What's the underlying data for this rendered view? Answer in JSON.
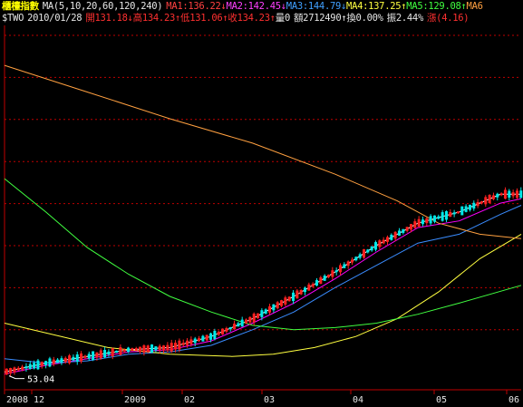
{
  "header": {
    "name": "櫃檯指數",
    "ma_spec": "MA(5,10,20,60,120,240)",
    "ma_items": [
      {
        "label": "MA1:136.22↓",
        "color": "#ff4040"
      },
      {
        "label": "MA2:142.45↓",
        "color": "#ff40ff"
      },
      {
        "label": "MA3:144.79↓",
        "color": "#40a0ff"
      },
      {
        "label": "MA4:137.25↑",
        "color": "#ffff40"
      },
      {
        "label": "MA5:129.08↑",
        "color": "#40ff40"
      },
      {
        "label": "MA6",
        "color": "#ffa040"
      }
    ],
    "symbol": "$TWO",
    "date": "2010/01/28",
    "open": "開131.18↓",
    "high": "高134.23↑",
    "low": "低131.06↑",
    "close": "收134.23↑",
    "volume": "量0",
    "amount": "額2712490↑",
    "turnover": "換0.00%",
    "amplitude": "振2.44%",
    "change": "漲(4.16)"
  },
  "chart_data": {
    "type": "line",
    "title": "櫃檯指數",
    "x_tick_labels": [
      "2008",
      "12",
      "2009",
      "02",
      "03",
      "04",
      "05",
      "06"
    ],
    "annotations": [
      "53.04"
    ],
    "min_marker": 53.04,
    "grid": true,
    "colors": {
      "up": "#ff2020",
      "down": "#00e8e8",
      "grid": "#c00000",
      "MA5": "#ffffff",
      "MA10": "#ff00ff",
      "MA20": "#3a8cff",
      "MA60": "#ffff40",
      "MA120": "#40ff40",
      "MA240": "#ffa040"
    },
    "series": [
      {
        "name": "MA5",
        "x": [
          0,
          10,
          20,
          30,
          40,
          50,
          60,
          70,
          80,
          90,
          100,
          110,
          120,
          125
        ],
        "values": [
          56,
          60,
          63,
          66,
          67,
          72,
          80,
          90,
          101,
          113,
          123,
          128,
          136,
          136
        ]
      },
      {
        "name": "MA10",
        "x": [
          0,
          10,
          20,
          30,
          40,
          50,
          60,
          70,
          80,
          90,
          100,
          110,
          120,
          125
        ],
        "values": [
          55,
          59,
          62,
          65,
          66,
          70,
          78,
          87,
          98,
          110,
          121,
          124,
          132,
          134
        ]
      },
      {
        "name": "MA20",
        "x": [
          0,
          10,
          20,
          30,
          40,
          50,
          60,
          70,
          80,
          90,
          100,
          110,
          120,
          125
        ],
        "values": [
          62,
          60,
          61,
          64,
          65,
          68,
          75,
          83,
          94,
          104,
          114,
          118,
          127,
          131
        ]
      },
      {
        "name": "MA60",
        "x": [
          0,
          25,
          40,
          55,
          65,
          75,
          85,
          95,
          105,
          115,
          125
        ],
        "values": [
          78,
          67,
          64,
          63,
          64,
          67,
          72,
          80,
          92,
          107,
          118
        ]
      },
      {
        "name": "MA120",
        "x": [
          0,
          10,
          20,
          30,
          40,
          50,
          60,
          70,
          80,
          90,
          100,
          110,
          125
        ],
        "values": [
          143,
          128,
          112,
          100,
          90,
          83,
          77,
          75,
          76,
          78,
          82,
          87,
          95
        ]
      },
      {
        "name": "MA240",
        "x": [
          0,
          20,
          40,
          60,
          80,
          95,
          105,
          115,
          125
        ],
        "values": [
          194,
          182,
          170,
          159,
          145,
          133,
          123,
          118,
          116
        ]
      }
    ]
  }
}
